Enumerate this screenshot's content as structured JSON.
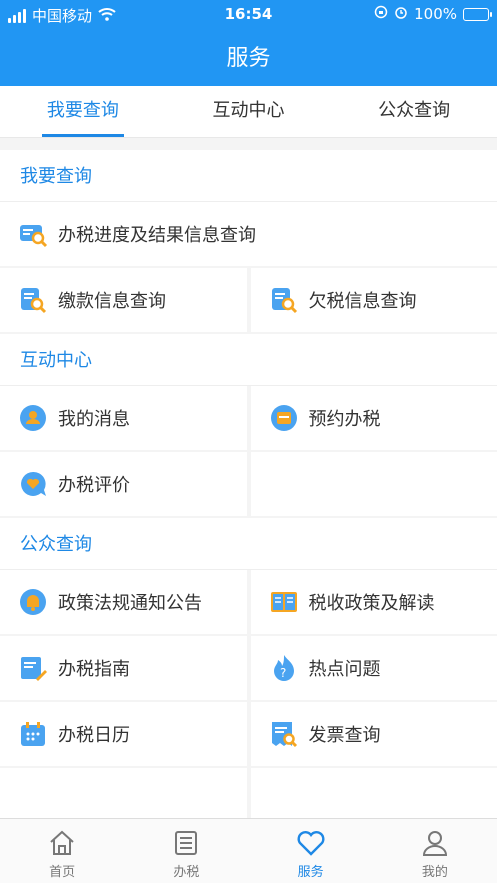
{
  "status": {
    "carrier": "中国移动",
    "time": "16:54",
    "battery": "100%"
  },
  "header": {
    "title": "服务"
  },
  "tabs": [
    {
      "label": "我要查询",
      "active": true
    },
    {
      "label": "互动中心",
      "active": false
    },
    {
      "label": "公众查询",
      "active": false
    }
  ],
  "sections": {
    "query": {
      "title": "我要查询",
      "items": [
        "办税进度及结果信息查询",
        "缴款信息查询",
        "欠税信息查询"
      ]
    },
    "interact": {
      "title": "互动中心",
      "items": [
        "我的消息",
        "预约办税",
        "办税评价"
      ]
    },
    "public": {
      "title": "公众查询",
      "items": [
        "政策法规通知公告",
        "税收政策及解读",
        "办税指南",
        "热点问题",
        "办税日历",
        "发票查询"
      ]
    }
  },
  "bottom_nav": [
    {
      "label": "首页",
      "icon": "home-icon"
    },
    {
      "label": "办税",
      "icon": "list-icon"
    },
    {
      "label": "服务",
      "icon": "heart-icon",
      "active": true
    },
    {
      "label": "我的",
      "icon": "user-icon"
    }
  ],
  "colors": {
    "primary": "#2196f3",
    "accent": "#1e88e5",
    "icon_orange": "#f5a623"
  }
}
